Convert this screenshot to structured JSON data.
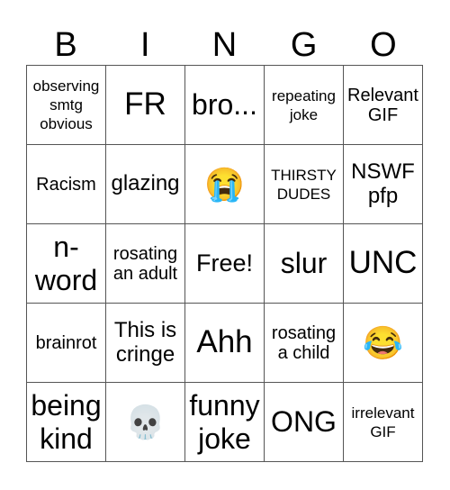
{
  "header": {
    "letters": [
      "B",
      "I",
      "N",
      "G",
      "O"
    ]
  },
  "board": {
    "cells": [
      {
        "text": "observing smtg obvious",
        "kind": "text",
        "size": "s16"
      },
      {
        "text": "FR",
        "kind": "text",
        "size": "s34"
      },
      {
        "text": "bro...",
        "kind": "text",
        "size": "s30"
      },
      {
        "text": "repeating joke",
        "kind": "text",
        "size": "s16"
      },
      {
        "text": "Relevant GIF",
        "kind": "text",
        "size": "s19"
      },
      {
        "text": "Racism",
        "kind": "text",
        "size": "s19"
      },
      {
        "text": "glazing",
        "kind": "text",
        "size": "s22"
      },
      {
        "text": "😭",
        "kind": "emoji",
        "icon": "loudly-crying-face-icon",
        "size": "emoji"
      },
      {
        "text": "THIRSTY DUDES",
        "kind": "text",
        "size": "s16"
      },
      {
        "text": "NSWF pfp",
        "kind": "text",
        "size": "s22"
      },
      {
        "text": "n-word",
        "kind": "text",
        "size": "s30"
      },
      {
        "text": "rosating an adult",
        "kind": "text",
        "size": "s19"
      },
      {
        "text": "Free!",
        "kind": "text",
        "size": "s26"
      },
      {
        "text": "slur",
        "kind": "text",
        "size": "s30"
      },
      {
        "text": "UNC",
        "kind": "text",
        "size": "s34"
      },
      {
        "text": "brainrot",
        "kind": "text",
        "size": "s19"
      },
      {
        "text": "This is cringe",
        "kind": "text",
        "size": "s22"
      },
      {
        "text": "Ahh",
        "kind": "text",
        "size": "s34"
      },
      {
        "text": "rosating a child",
        "kind": "text",
        "size": "s19"
      },
      {
        "text": "😂",
        "kind": "emoji",
        "icon": "tears-of-joy-face-icon",
        "size": "emoji"
      },
      {
        "text": "being kind",
        "kind": "text",
        "size": "s30"
      },
      {
        "text": "💀",
        "kind": "emoji",
        "icon": "skull-icon",
        "size": "emoji"
      },
      {
        "text": "funny joke",
        "kind": "text",
        "size": "s30"
      },
      {
        "text": "ONG",
        "kind": "text",
        "size": "s30"
      },
      {
        "text": "irrelevant GIF",
        "kind": "text",
        "size": "s16"
      }
    ]
  },
  "colors": {
    "grid_line": "#555555",
    "text": "#000000",
    "background": "#ffffff"
  }
}
